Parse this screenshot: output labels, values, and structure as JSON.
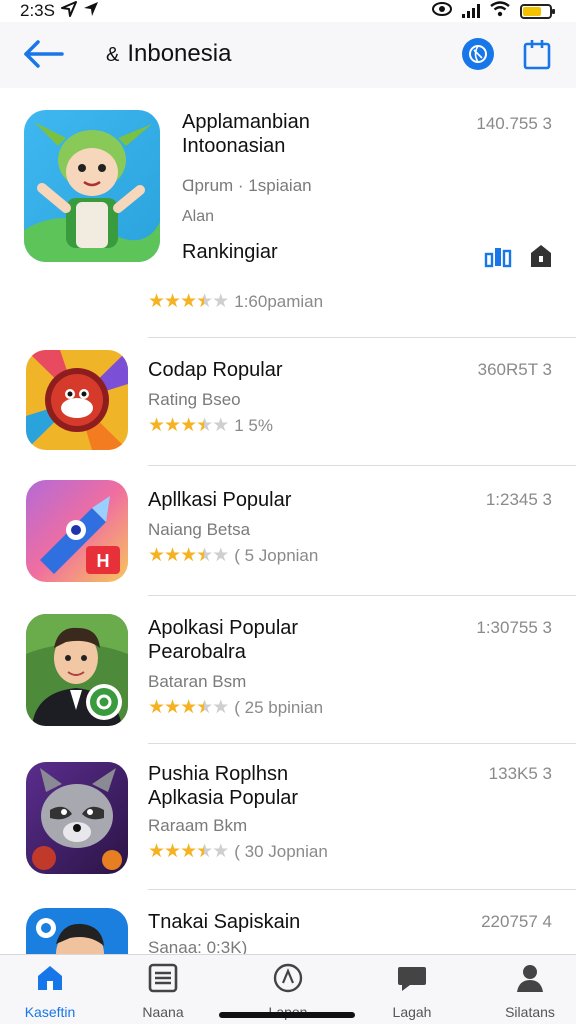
{
  "status_bar": {
    "time": "2:3S",
    "location_icon": "location-arrow-icon",
    "battery_color": "#f2c200"
  },
  "header": {
    "title": "Inbonesia",
    "title_prefix": "&",
    "back_icon": "back-arrow-icon",
    "globe_icon": "globe-icon",
    "share_icon": "share-icon",
    "accent": "#1877e8"
  },
  "apps": [
    {
      "name": "Applamanbian",
      "name2": "Intoonasian",
      "sub1": "Ɑprum · 1spiaian",
      "sub2": "Alan",
      "extra": "Rankingiar",
      "size": "140.755 3",
      "rating": 3.5,
      "rating_text": "1:60pamian"
    },
    {
      "name": "Codap Ropular",
      "sub1": "Rating Bseo",
      "size": "360R5T 3",
      "rating": 3.5,
      "rating_text": "1 5%"
    },
    {
      "name": "Apllkasi Popular",
      "sub1": "Naiang Betsa",
      "size": "1:2345 3",
      "rating": 3.5,
      "rating_text": "( 5 Jopnian"
    },
    {
      "name": "Apolkasi Popular",
      "name2": "Pearobalra",
      "sub1": "Bataran Bsm",
      "size": "1:30755 3",
      "rating": 3.5,
      "rating_text": "( 25 bpinian"
    },
    {
      "name": "Pushia Roplhsn",
      "name2": "Aplkasia Popular",
      "sub1": "Raraam Bkm",
      "size": "133K5 3",
      "rating": 3.5,
      "rating_text": "( 30 Jopnian"
    },
    {
      "name": "Tnakai Sapiskain",
      "sub1": "Sanaa: 0:3K)",
      "size": "220757 4"
    }
  ],
  "tabs": [
    {
      "label": "Kaseftin",
      "icon": "home-icon",
      "active": true
    },
    {
      "label": "Naana",
      "icon": "list-icon",
      "active": false
    },
    {
      "label": "Lapon",
      "icon": "compass-icon",
      "active": false
    },
    {
      "label": "Lagah",
      "icon": "chat-icon",
      "active": false
    },
    {
      "label": "Silatans",
      "icon": "person-icon",
      "active": false
    }
  ]
}
